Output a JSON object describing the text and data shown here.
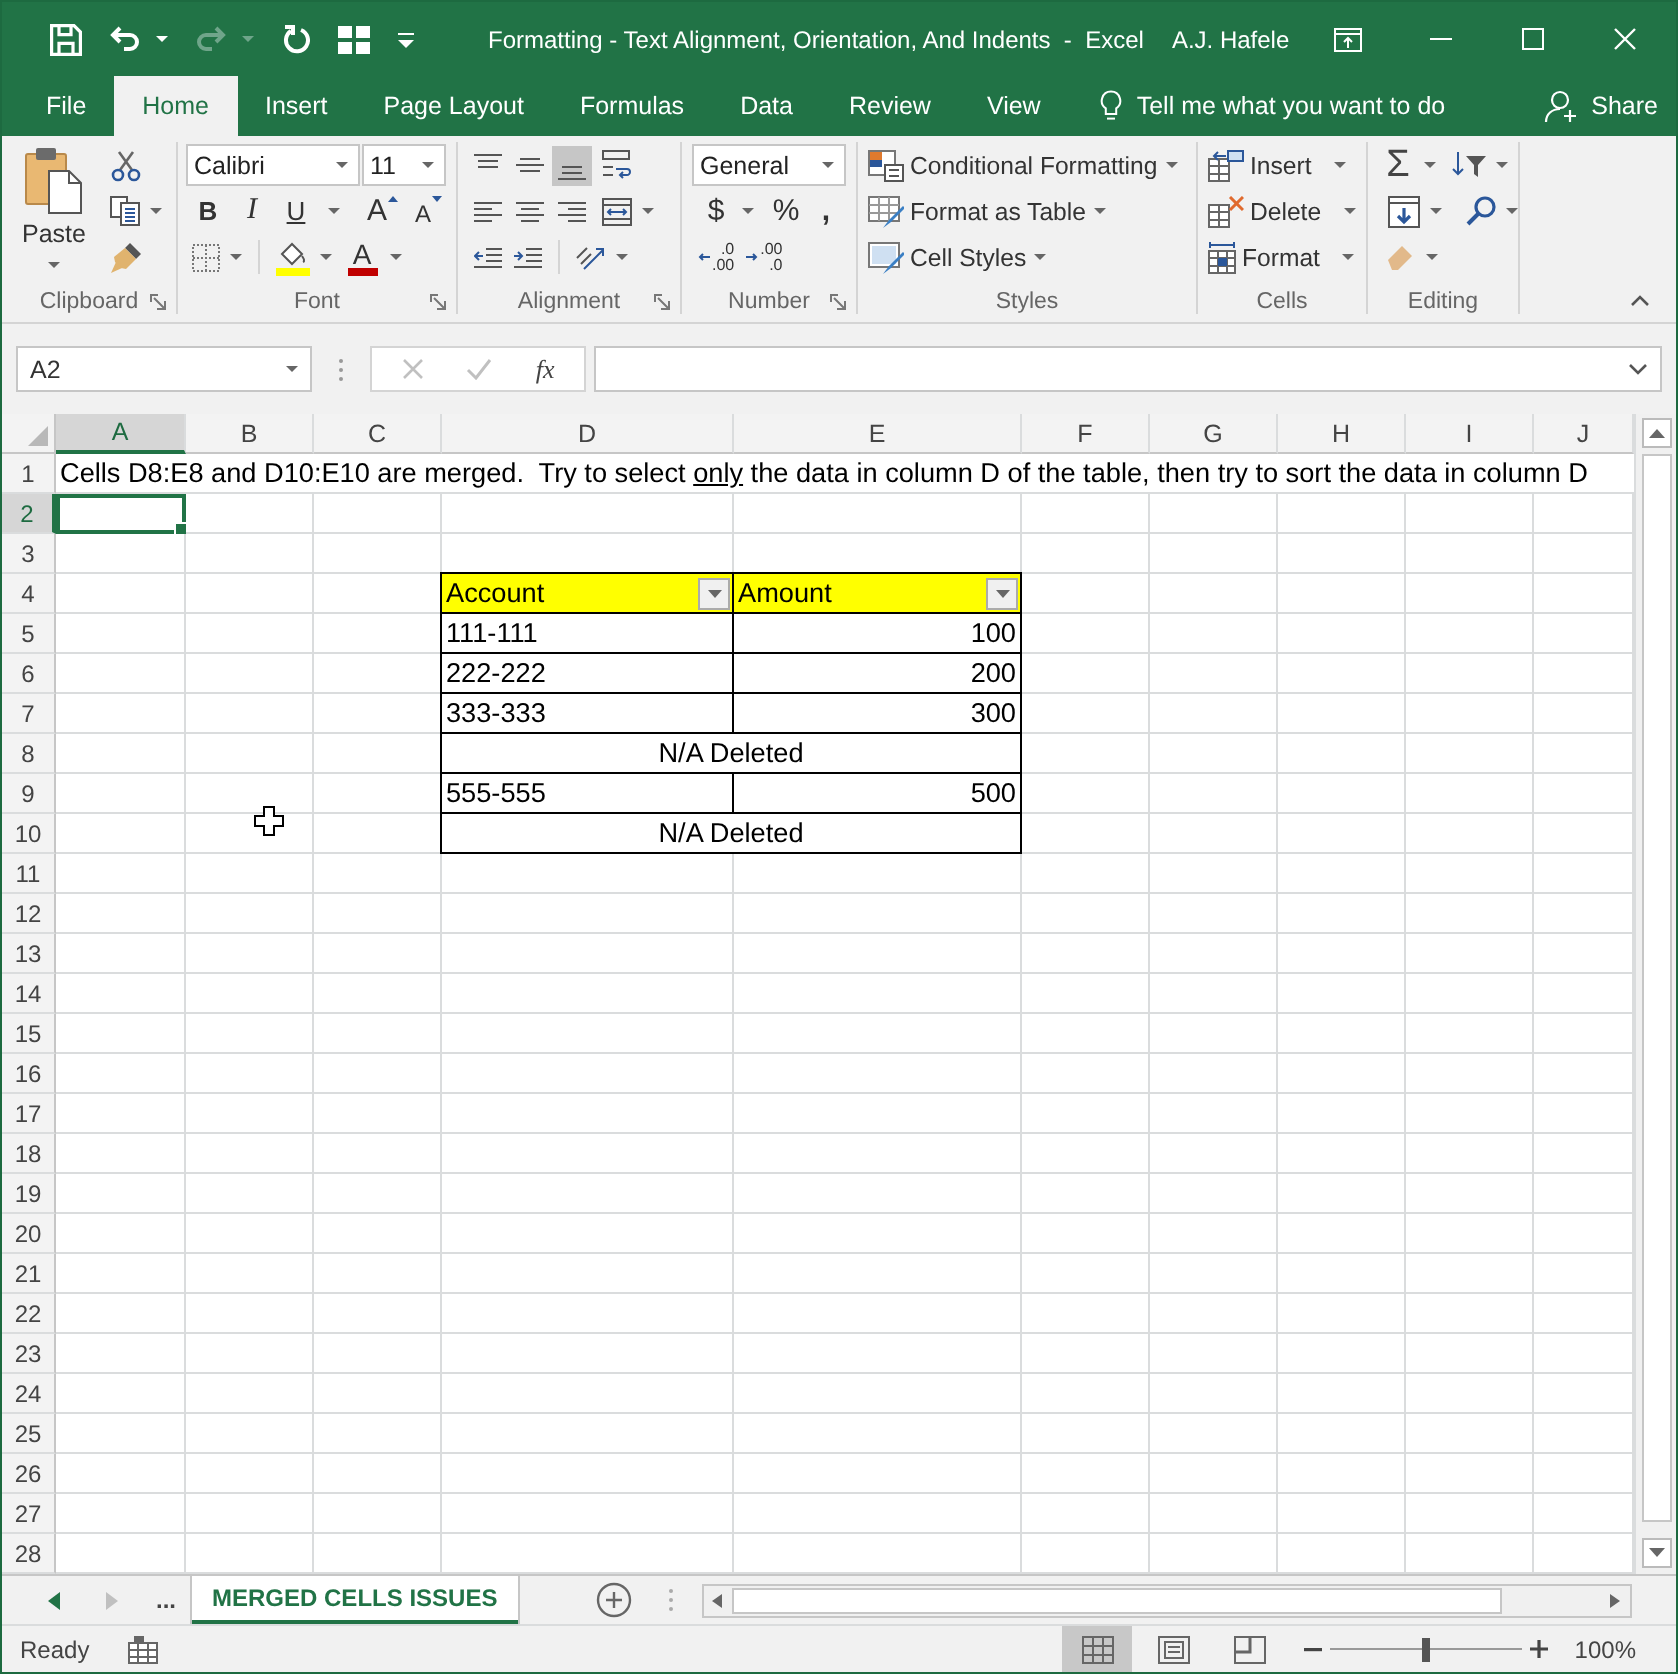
{
  "window": {
    "title": "Formatting - Text Alignment, Orientation, And Indents  -  Excel",
    "user": "A.J. Hafele"
  },
  "quick_access": [
    {
      "kind": "save",
      "disabled": false
    },
    {
      "kind": "undo",
      "disabled": false
    },
    {
      "kind": "redo",
      "disabled": true
    },
    {
      "kind": "refresh",
      "disabled": false
    },
    {
      "kind": "grid",
      "disabled": false
    }
  ],
  "ribbon_tabs": [
    {
      "label": "File",
      "selected": false
    },
    {
      "label": "Home",
      "selected": true
    },
    {
      "label": "Insert",
      "selected": false
    },
    {
      "label": "Page Layout",
      "selected": false
    },
    {
      "label": "Formulas",
      "selected": false
    },
    {
      "label": "Data",
      "selected": false
    },
    {
      "label": "Review",
      "selected": false
    },
    {
      "label": "View",
      "selected": false
    }
  ],
  "tell_me": {
    "placeholder": "Tell me what you want to do"
  },
  "share": {
    "label": "Share"
  },
  "ribbon": {
    "clipboard": {
      "paste": "Paste",
      "label": "Clipboard"
    },
    "font": {
      "name": "Calibri",
      "size": "11",
      "bold": "B",
      "italic": "I",
      "underline": "U",
      "grow": "A",
      "shrink": "A",
      "paint_label": "A",
      "label": "Font"
    },
    "alignment": {
      "vertical": [
        {
          "kind": "top",
          "selected": false
        },
        {
          "kind": "middle",
          "selected": false
        },
        {
          "kind": "bottom",
          "selected": true
        }
      ],
      "horizontal": [
        {
          "kind": "left",
          "selected": false
        },
        {
          "kind": "center",
          "selected": false
        },
        {
          "kind": "right",
          "selected": false
        }
      ],
      "label": "Alignment"
    },
    "number": {
      "format": "General",
      "currency": "$",
      "percent": "%",
      "comma": ",",
      "increase_decimal": [
        ".0",
        ".00"
      ],
      "decrease_decimal": [
        ".00",
        ".0"
      ],
      "label": "Number"
    },
    "styles": {
      "items": [
        "Conditional Formatting",
        "Format as Table",
        "Cell Styles"
      ],
      "label": "Styles"
    },
    "cells": {
      "items": [
        "Insert",
        "Delete",
        "Format"
      ],
      "label": "Cells"
    },
    "editing": {
      "autosum": "Σ",
      "label": "Editing"
    }
  },
  "formula_bar": {
    "name_box": "A2",
    "cancel_disabled": true,
    "enter_disabled": true,
    "function_label": "fx"
  },
  "sheet": {
    "columns": [
      {
        "label": "A",
        "selected": true
      },
      {
        "label": "B",
        "selected": false
      },
      {
        "label": "C",
        "selected": false
      },
      {
        "label": "D",
        "selected": false
      },
      {
        "label": "E",
        "selected": false
      },
      {
        "label": "F",
        "selected": false
      },
      {
        "label": "G",
        "selected": false
      },
      {
        "label": "H",
        "selected": false
      },
      {
        "label": "I",
        "selected": false
      },
      {
        "label": "J",
        "selected": false
      }
    ],
    "rows": [
      {
        "label": "1",
        "selected": false
      },
      {
        "label": "2",
        "selected": true
      },
      {
        "label": "3",
        "selected": false
      },
      {
        "label": "4",
        "selected": false
      },
      {
        "label": "5",
        "selected": false
      },
      {
        "label": "6",
        "selected": false
      },
      {
        "label": "7",
        "selected": false
      },
      {
        "label": "8",
        "selected": false
      },
      {
        "label": "9",
        "selected": false
      },
      {
        "label": "10",
        "selected": false
      },
      {
        "label": "11",
        "selected": false
      },
      {
        "label": "12",
        "selected": false
      },
      {
        "label": "13",
        "selected": false
      },
      {
        "label": "14",
        "selected": false
      },
      {
        "label": "15",
        "selected": false
      },
      {
        "label": "16",
        "selected": false
      },
      {
        "label": "17",
        "selected": false
      },
      {
        "label": "18",
        "selected": false
      },
      {
        "label": "19",
        "selected": false
      },
      {
        "label": "20",
        "selected": false
      },
      {
        "label": "21",
        "selected": false
      },
      {
        "label": "22",
        "selected": false
      },
      {
        "label": "23",
        "selected": false
      },
      {
        "label": "24",
        "selected": false
      },
      {
        "label": "25",
        "selected": false
      },
      {
        "label": "26",
        "selected": false
      },
      {
        "label": "27",
        "selected": false
      },
      {
        "label": "28",
        "selected": false
      }
    ],
    "note": {
      "parts": [
        {
          "text": "Cells D8:E8 and D10:E10 are merged.  Try to select ",
          "underline": false
        },
        {
          "text": "only",
          "underline": true
        },
        {
          "text": " the data in column D of the table, then try to sort the data in column D",
          "underline": false
        }
      ]
    },
    "table": {
      "header": [
        {
          "text": "Account",
          "filter": true
        },
        {
          "text": "Amount",
          "filter": true
        }
      ],
      "rows": [
        {
          "kind": "data",
          "account": "111-111",
          "amount": "100"
        },
        {
          "kind": "data",
          "account": "222-222",
          "amount": "200"
        },
        {
          "kind": "data",
          "account": "333-333",
          "amount": "300"
        },
        {
          "kind": "merged",
          "text": "N/A Deleted"
        },
        {
          "kind": "data",
          "account": "555-555",
          "amount": "500"
        },
        {
          "kind": "merged",
          "text": "N/A Deleted"
        }
      ]
    }
  },
  "sheet_tabs": {
    "nav": [
      {
        "kind": "previous",
        "disabled": false
      },
      {
        "kind": "next",
        "disabled": true
      }
    ],
    "overflow": "...",
    "tabs": [
      {
        "label": "MERGED CELLS ISSUES",
        "selected": true
      }
    ]
  },
  "status_bar": {
    "status": "Ready",
    "views": [
      {
        "kind": "normal",
        "selected": true
      },
      {
        "kind": "page_layout",
        "selected": false
      },
      {
        "kind": "page_break",
        "selected": false
      }
    ],
    "zoom": {
      "level": 0.5,
      "reading": "100%"
    }
  }
}
